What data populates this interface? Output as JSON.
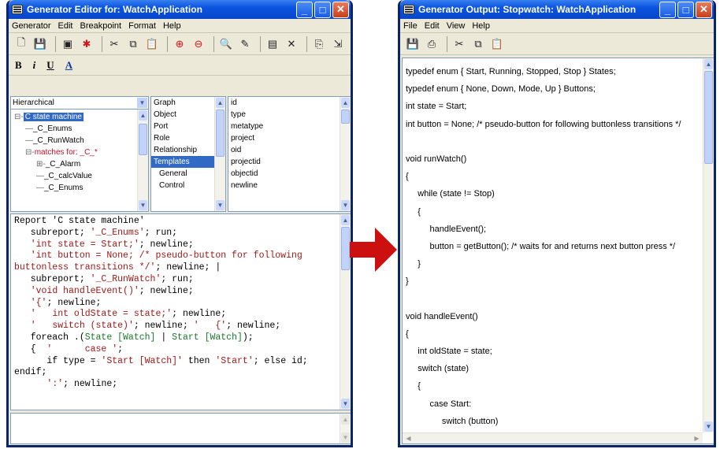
{
  "left_window": {
    "title": "Generator Editor for: WatchApplication",
    "menu": [
      "Generator",
      "Edit",
      "Breakpoint",
      "Format",
      "Help"
    ],
    "format_buttons": [
      "B",
      "i",
      "U",
      "A"
    ],
    "view_select": "Hierarchical",
    "tree": [
      {
        "label": "C state machine",
        "selected": true,
        "indent": 0,
        "prefix": "⊟-"
      },
      {
        "label": "_C_Enums",
        "indent": 1,
        "prefix": "—"
      },
      {
        "label": "_C_RunWatch",
        "indent": 1,
        "prefix": "—"
      },
      {
        "label": "matches for: _C_*",
        "indent": 1,
        "prefix": "⊟-",
        "red": true
      },
      {
        "label": "_C_Alarm",
        "indent": 2,
        "prefix": "⊞-"
      },
      {
        "label": "_C_calcValue",
        "indent": 2,
        "prefix": "—"
      },
      {
        "label": "_C_Enums",
        "indent": 2,
        "prefix": "—"
      }
    ],
    "type_list": [
      "Graph",
      "Object",
      "Port",
      "Role",
      "Relationship",
      "Templates",
      "General",
      "Control"
    ],
    "type_list_selected": 5,
    "prop_list": [
      "id",
      "type",
      "metatype",
      "project",
      "oid",
      "projectid",
      "objectid",
      "newline"
    ],
    "code_lines": [
      [
        {
          "t": "Report 'C state machine'",
          "c": "k"
        }
      ],
      [
        {
          "t": "   subreport; ",
          "c": "k"
        },
        {
          "t": "'_C_Enums'",
          "c": "s"
        },
        {
          "t": "; run;",
          "c": "k"
        }
      ],
      [
        {
          "t": "   ",
          "c": "k"
        },
        {
          "t": "'int state = Start;'",
          "c": "s"
        },
        {
          "t": "; newline;",
          "c": "k"
        }
      ],
      [
        {
          "t": "   ",
          "c": "k"
        },
        {
          "t": "'int button = None; /* pseudo-button for following",
          "c": "s"
        }
      ],
      [
        {
          "t": "buttonless transitions */'",
          "c": "s"
        },
        {
          "t": "; newline; |",
          "c": "k"
        }
      ],
      [
        {
          "t": "   subreport; ",
          "c": "k"
        },
        {
          "t": "'_C_RunWatch'",
          "c": "s"
        },
        {
          "t": "; run;",
          "c": "k"
        }
      ],
      [
        {
          "t": "   ",
          "c": "k"
        },
        {
          "t": "'void handleEvent()'",
          "c": "s"
        },
        {
          "t": "; newline;",
          "c": "k"
        }
      ],
      [
        {
          "t": "   ",
          "c": "k"
        },
        {
          "t": "'{'",
          "c": "s"
        },
        {
          "t": "; newline;",
          "c": "k"
        }
      ],
      [
        {
          "t": "   ",
          "c": "k"
        },
        {
          "t": "'   int oldState = state;'",
          "c": "s"
        },
        {
          "t": "; newline;",
          "c": "k"
        }
      ],
      [
        {
          "t": "   ",
          "c": "k"
        },
        {
          "t": "'   switch (state)'",
          "c": "s"
        },
        {
          "t": "; newline; ",
          "c": "k"
        },
        {
          "t": "'   {'",
          "c": "s"
        },
        {
          "t": "; newline;",
          "c": "k"
        }
      ],
      [
        {
          "t": "   foreach .(",
          "c": "k"
        },
        {
          "t": "State [Watch]",
          "c": "g"
        },
        {
          "t": " | ",
          "c": "k"
        },
        {
          "t": "Start [Watch]",
          "c": "g"
        },
        {
          "t": ");",
          "c": "k"
        }
      ],
      [
        {
          "t": "   {  ",
          "c": "k"
        },
        {
          "t": "'      case '",
          "c": "s"
        },
        {
          "t": ";",
          "c": "k"
        }
      ],
      [
        {
          "t": "      if type = ",
          "c": "k"
        },
        {
          "t": "'Start [Watch]'",
          "c": "s"
        },
        {
          "t": " then ",
          "c": "k"
        },
        {
          "t": "'Start'",
          "c": "s"
        },
        {
          "t": "; else id;",
          "c": "k"
        }
      ],
      [
        {
          "t": "endif;",
          "c": "k"
        }
      ],
      [
        {
          "t": "      ",
          "c": "k"
        },
        {
          "t": "':'",
          "c": "s"
        },
        {
          "t": "; newline;",
          "c": "k"
        }
      ]
    ]
  },
  "right_window": {
    "title": "Generator Output: Stopwatch: WatchApplication",
    "menu": [
      "File",
      "Edit",
      "View",
      "Help"
    ],
    "output_lines": [
      "typedef enum { Start, Running, Stopped, Stop } States;",
      "typedef enum { None, Down, Mode, Up } Buttons;",
      "int state = Start;",
      "int button = None; /* pseudo-button for following buttonless transitions */",
      "",
      "void runWatch()",
      "{",
      "     while (state != Stop)",
      "     {",
      "          handleEvent();",
      "          button = getButton(); /* waits for and returns next button press */",
      "     }",
      "}",
      "",
      "void handleEvent()",
      "{",
      "     int oldState = state;",
      "     switch (state)",
      "     {",
      "          case Start:",
      "               switch (button)"
    ]
  },
  "colors": {
    "accent": "#0a54e0",
    "selection": "#316ac5",
    "arrow": "#cc1010",
    "string": "#a01818",
    "type": "#187a2a"
  }
}
